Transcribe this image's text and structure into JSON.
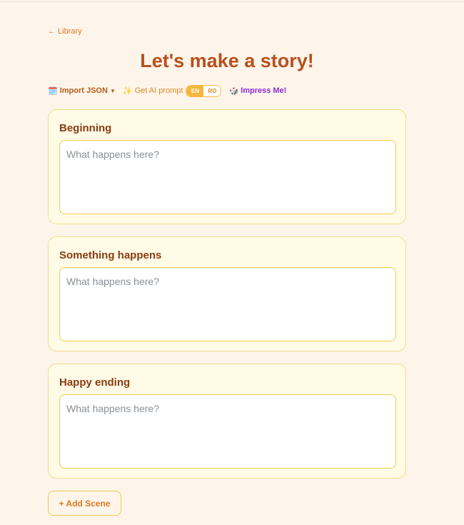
{
  "nav": {
    "back_label": "← Library"
  },
  "page": {
    "title": "Let's make a story!"
  },
  "toolbar": {
    "import_icon": "🗓️",
    "import_label": "Import JSON",
    "import_caret": "▼",
    "ai_icon": "✨",
    "ai_label": "Get AI prompt",
    "languages": [
      {
        "code": "EN",
        "active": true
      },
      {
        "code": "RO",
        "active": false
      }
    ],
    "impress_icon": "🎲",
    "impress_label": "Impress Me!"
  },
  "scenes": [
    {
      "title": "Beginning",
      "value": "",
      "placeholder": "What happens here?"
    },
    {
      "title": "Something happens",
      "value": "",
      "placeholder": "What happens here?"
    },
    {
      "title": "Happy ending",
      "value": "",
      "placeholder": "What happens here?"
    }
  ],
  "actions": {
    "add_scene_label": "+ Add Scene"
  },
  "colors": {
    "background": "#fef5ea",
    "title": "#b8501e",
    "accent": "#f6b73c",
    "impress": "#8a2bd6"
  }
}
